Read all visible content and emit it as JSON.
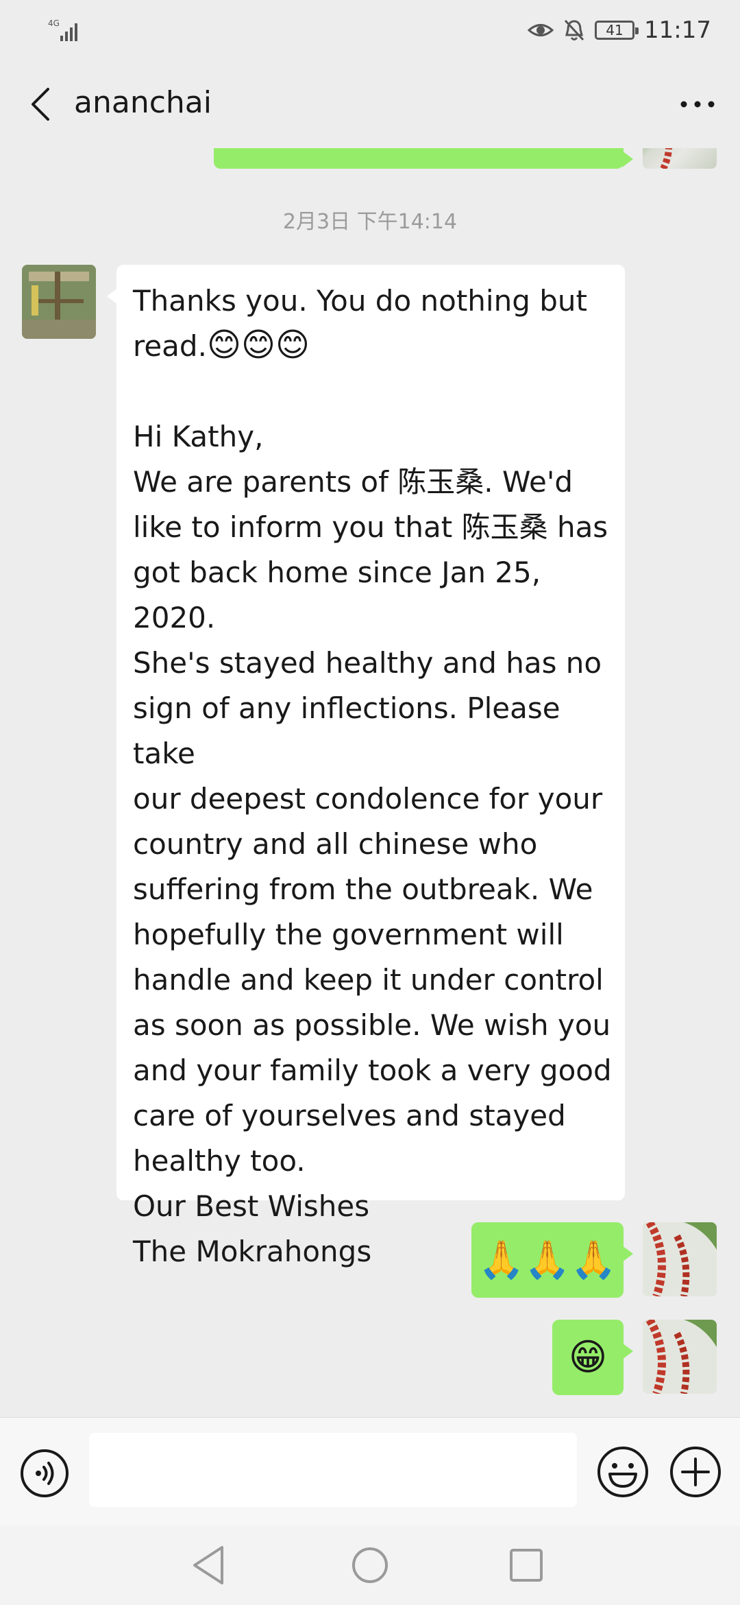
{
  "status_bar": {
    "network": "4G",
    "battery": "41",
    "time": "11:17"
  },
  "header": {
    "title": "ananchai"
  },
  "chat": {
    "timestamp": "2月3日 下午14:14",
    "incoming_message": {
      "line1": "Thanks you. You do nothing but",
      "line2": "read.",
      "line2_emojis": "😊😊😊",
      "body": "\nHi Kathy,\nWe are parents of 陈玉桑. We'd\nlike to inform you that 陈玉桑 has\ngot back home since Jan 25, 2020.\nShe's stayed healthy and has no\nsign of any inflections. Please take\nour deepest condolence for your\ncountry and all chinese who\nsuffering from the outbreak. We\nhopefully the government will\nhandle and keep it under control\nas soon as possible. We wish you\nand your family took a very good\ncare of yourselves and stayed\nhealthy too.\nOur Best Wishes\nThe Mokrahongs"
    },
    "outgoing_1": "🙏🙏🙏",
    "outgoing_2": "😁"
  },
  "input": {
    "placeholder": ""
  },
  "colors": {
    "background": "#ededed",
    "outgoing_bubble": "#95ec69",
    "incoming_bubble": "#ffffff",
    "timestamp": "#9b9b9b"
  },
  "icons": {
    "back": "chevron-left-icon",
    "more": "more-dots-icon",
    "voice": "voice-icon",
    "emoji": "smiley-icon",
    "plus": "plus-icon"
  }
}
